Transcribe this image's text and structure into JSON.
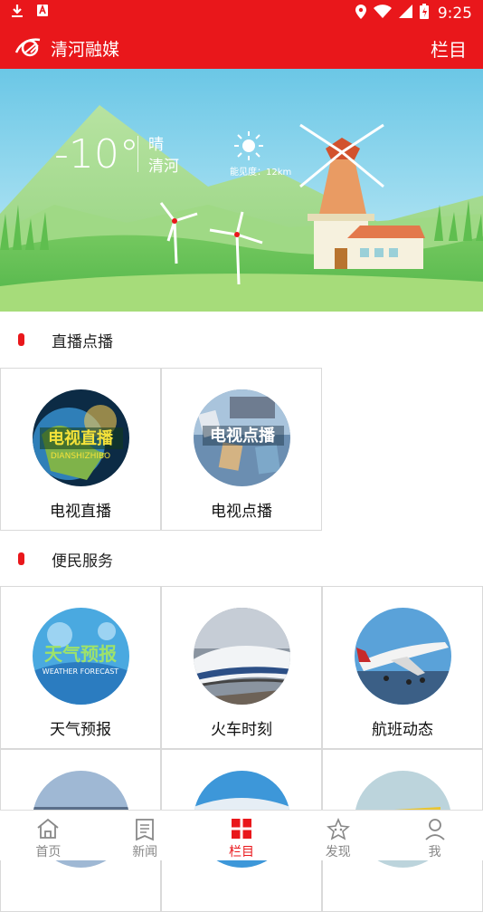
{
  "status_bar": {
    "time": "9:25"
  },
  "app_bar": {
    "title": "清河融媒",
    "right_label": "栏目"
  },
  "weather": {
    "temperature": "-10°",
    "condition": "晴",
    "city": "清河",
    "visibility": "能见度：12km"
  },
  "sections": [
    {
      "title": "直播点播",
      "items": [
        {
          "label": "电视直播",
          "image_text": "电视直播",
          "sub_text": "DIANSHIZHIBO"
        },
        {
          "label": "电视点播",
          "image_text": "电视点播"
        }
      ]
    },
    {
      "title": "便民服务",
      "items": [
        {
          "label": "天气预报",
          "image_text": "天气预报",
          "sub_text": "WEATHER FORECAST"
        },
        {
          "label": "火车时刻"
        },
        {
          "label": "航班动态"
        }
      ]
    }
  ],
  "tabs": [
    {
      "label": "首页",
      "icon": "home-icon"
    },
    {
      "label": "新闻",
      "icon": "news-icon"
    },
    {
      "label": "栏目",
      "icon": "grid-icon",
      "active": true
    },
    {
      "label": "发现",
      "icon": "discover-icon"
    },
    {
      "label": "我",
      "icon": "profile-icon"
    }
  ],
  "colors": {
    "brand_red": "#e9171b",
    "sky": "#7fd2ea",
    "grass": "#6cc05c"
  }
}
